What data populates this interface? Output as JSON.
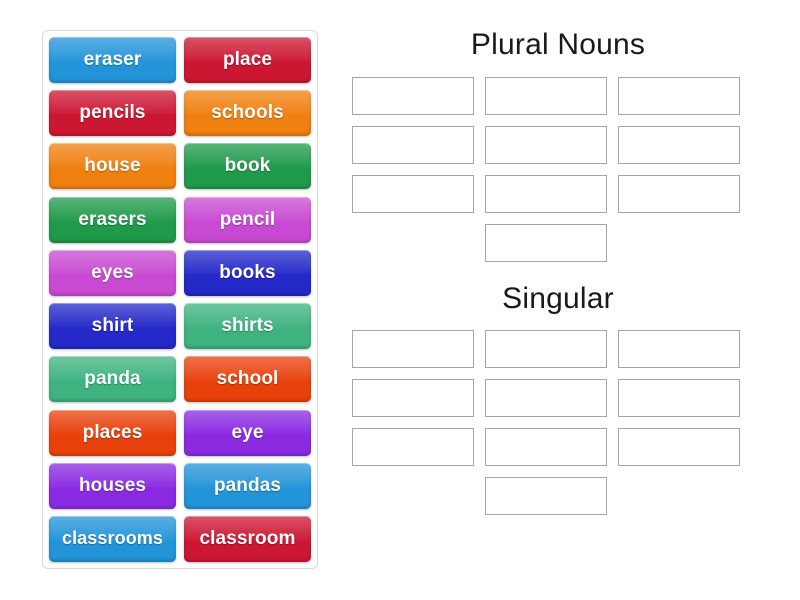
{
  "activity": {
    "type": "group-sort",
    "tray_label": "word-tile-tray"
  },
  "tiles": [
    {
      "label": "eraser",
      "color": "#2394d8"
    },
    {
      "label": "place",
      "color": "#cc1733"
    },
    {
      "label": "pencils",
      "color": "#cc1733"
    },
    {
      "label": "schools",
      "color": "#f0800f"
    },
    {
      "label": "house",
      "color": "#f0800f"
    },
    {
      "label": "book",
      "color": "#1f9a4b"
    },
    {
      "label": "erasers",
      "color": "#1f9a4b"
    },
    {
      "label": "pencil",
      "color": "#c84ad2"
    },
    {
      "label": "eyes",
      "color": "#c84ad2"
    },
    {
      "label": "books",
      "color": "#2429c8"
    },
    {
      "label": "shirt",
      "color": "#2429c8"
    },
    {
      "label": "shirts",
      "color": "#3eb380"
    },
    {
      "label": "panda",
      "color": "#3eb380"
    },
    {
      "label": "school",
      "color": "#e8410c"
    },
    {
      "label": "places",
      "color": "#e8410c"
    },
    {
      "label": "eye",
      "color": "#8a2be2"
    },
    {
      "label": "houses",
      "color": "#8a2be2"
    },
    {
      "label": "pandas",
      "color": "#2394d8"
    },
    {
      "label": "classrooms",
      "color": "#2394d8"
    },
    {
      "label": "classroom",
      "color": "#cc1733"
    }
  ],
  "groups": [
    {
      "title": "Plural Nouns",
      "slot_count": 10,
      "slots": [
        "",
        "",
        "",
        "",
        "",
        "",
        "",
        "",
        "",
        ""
      ]
    },
    {
      "title": "Singular",
      "slot_count": 10,
      "slots": [
        "",
        "",
        "",
        "",
        "",
        "",
        "",
        "",
        "",
        ""
      ]
    }
  ],
  "colors": {
    "tray_border": "#d8d8d8",
    "slot_border": "#a6a6a6",
    "page_background": "#ffffff",
    "title_text": "#1a1a1a",
    "tile_text": "#ffffff"
  }
}
